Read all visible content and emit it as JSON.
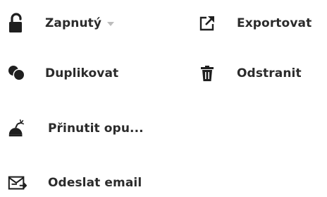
{
  "actions": {
    "zapnuty": {
      "label": "Zapnutý",
      "icon": "unlock-icon"
    },
    "export": {
      "label": "Exportovat",
      "icon": "external-link-icon"
    },
    "duplikovat": {
      "label": "Duplikovat",
      "icon": "duplicate-icon"
    },
    "odstranit": {
      "label": "Odstranit",
      "icon": "trash-icon"
    },
    "prinutit": {
      "label": "Přinutit opu...",
      "icon": "force-unsubscribe-icon"
    },
    "email": {
      "label": "Odeslat email",
      "icon": "send-email-icon"
    }
  },
  "colors": {
    "text": "#2b2b2b",
    "icon": "#1f1f1f",
    "caret": "#bdbdbd",
    "background": "#ffffff"
  }
}
